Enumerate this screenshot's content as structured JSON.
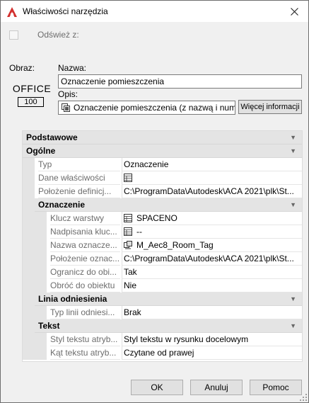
{
  "window": {
    "title": "Właściwości narzędzia"
  },
  "refresh": {
    "label": "Odśwież z:",
    "checked": false
  },
  "image": {
    "label": "Obraz:",
    "preview_text": "OFFICE",
    "preview_number": "100"
  },
  "name": {
    "label": "Nazwa:",
    "value": "Oznaczenie pomieszczenia"
  },
  "description": {
    "label": "Opis:",
    "value": "Oznaczenie pomieszczenia (z nazwą i nume"
  },
  "more_info_button": "Więcej informacji",
  "properties": {
    "basic_header": "Podstawowe",
    "general": {
      "header": "Ogólne",
      "rows": [
        {
          "name": "Typ",
          "value": "Oznaczenie",
          "icon": ""
        },
        {
          "name": "Dane właściwości",
          "value": "",
          "icon": "table-icon"
        },
        {
          "name": "Położenie definicj...",
          "value": "C:\\ProgramData\\Autodesk\\ACA  2021\\plk\\St...",
          "icon": ""
        }
      ]
    },
    "marking": {
      "header": "Oznaczenie",
      "rows": [
        {
          "name": "Klucz warstwy",
          "value": "SPACENO",
          "icon": "table-icon"
        },
        {
          "name": "Nadpisania kluc...",
          "value": "--",
          "icon": "table-icon"
        },
        {
          "name": "Nazwa oznacze...",
          "value": "M_Aec8_Room_Tag",
          "icon": "block-icon"
        },
        {
          "name": "Położenie oznac...",
          "value": "C:\\ProgramData\\Autodesk\\ACA  2021\\plk\\St...",
          "icon": ""
        },
        {
          "name": "Ogranicz do obi...",
          "value": "Tak",
          "icon": ""
        },
        {
          "name": "Obróć do obiektu",
          "value": "Nie",
          "icon": ""
        }
      ]
    },
    "leader": {
      "header": "Linia odniesienia",
      "rows": [
        {
          "name": "Typ linii odniesi...",
          "value": "Brak",
          "icon": ""
        }
      ]
    },
    "text": {
      "header": "Tekst",
      "rows": [
        {
          "name": "Styl tekstu atryb...",
          "value": "Styl tekstu w rysunku docelowym",
          "icon": ""
        },
        {
          "name": "Kąt tekstu atryb...",
          "value": "Czytane od prawej",
          "icon": ""
        }
      ]
    }
  },
  "buttons": {
    "ok": "OK",
    "cancel": "Anuluj",
    "help": "Pomoc"
  },
  "colors": {
    "accent_red": "#d3302f",
    "header_gray": "#e4e4e4"
  }
}
